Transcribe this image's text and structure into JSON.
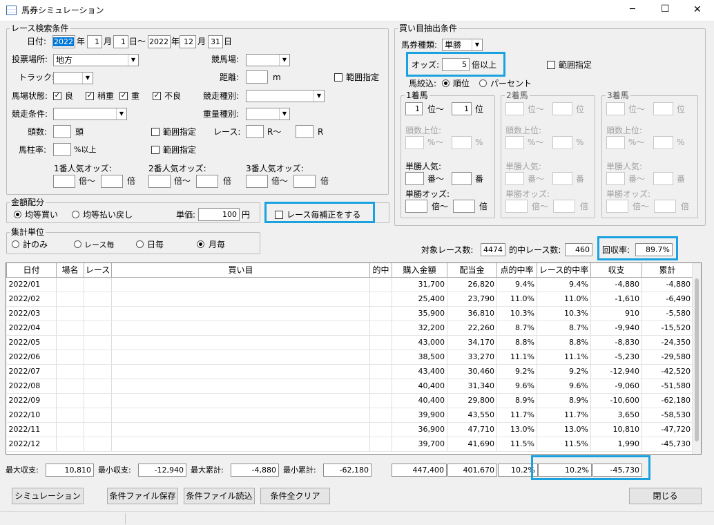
{
  "window": {
    "title": "馬券シミュレーション",
    "min": "─",
    "max": "☐",
    "close": "✕"
  },
  "race": {
    "group_title": "レース検索条件",
    "date_label": "日付:",
    "from_year": "2022",
    "year_unit": "年",
    "from_month": "1",
    "month_unit": "月",
    "from_day": "1",
    "day_tilde": "日〜",
    "to_year": "2022",
    "to_month": "12",
    "to_day": "31",
    "day_unit": "日",
    "venue_label": "投票場所:",
    "venue_value": "地方",
    "course_label": "競馬場:",
    "track_label": "トラック:",
    "distance_label": "距離:",
    "distance_unit": "m",
    "range_label": "範囲指定",
    "condition_label": "馬場状態:",
    "conditions": [
      "良",
      "稍重",
      "重",
      "不良"
    ],
    "race_kind_label": "競走種別:",
    "race_cond_label": "競走条件:",
    "weight_label": "重量種別:",
    "heads_label": "頭数:",
    "heads_unit": "頭",
    "heads_range": "範囲指定",
    "race_label": "レース:",
    "race_r_from": "R〜",
    "race_r": "R",
    "umabashira_label": "馬柱率:",
    "umabashira_unit": "%以上",
    "umabashira_range": "範囲指定",
    "pop1_label": "1番人気オッズ:",
    "pop2_label": "2番人気オッズ:",
    "pop3_label": "3番人気オッズ:",
    "times_from": "倍〜",
    "times": "倍"
  },
  "amount": {
    "group_title": "金額配分",
    "opt1": "均等買い",
    "opt2": "均等払い戻し",
    "unit_label": "単価:",
    "unit_value": "100",
    "unit_yen": "円",
    "correct_label": "レース毎補正をする"
  },
  "aggregate": {
    "group_title": "集計単位",
    "opts": [
      "計のみ",
      "レース毎",
      "日毎",
      "月毎"
    ]
  },
  "buy": {
    "group_title": "買い目抽出条件",
    "type_label": "馬券種類:",
    "type_value": "単勝",
    "odds_label": "オッズ:",
    "odds_value": "5",
    "odds_unit": "倍以上",
    "range_label": "範囲指定",
    "narrow_label": "馬絞込:",
    "narrow_rank": "順位",
    "narrow_pct": "パーセント",
    "h1_title": "1着馬",
    "h2_title": "2着馬",
    "h3_title": "3着馬",
    "h1_from": "1",
    "h1_to": "1",
    "rank_from": "位〜",
    "rank": "位",
    "heads_top": "頭数上位:",
    "pct_from": "%〜",
    "pct": "%",
    "pop_label": "単勝人気:",
    "ban_from": "番〜",
    "ban": "番",
    "odds_tan": "単勝オッズ:",
    "bai_from": "倍〜",
    "bai": "倍"
  },
  "summary": {
    "target_label": "対象レース数:",
    "target_value": "4474",
    "hit_label": "的中レース数:",
    "hit_value": "460",
    "recovery_label": "回収率:",
    "recovery_value": "89.7%"
  },
  "table": {
    "headers": [
      "日付",
      "場名",
      "レース",
      "買い目",
      "的中",
      "購入金額",
      "配当金",
      "点的中率",
      "レース的中率",
      "収支",
      "累計"
    ],
    "rows": [
      [
        "2022/01",
        "",
        "",
        "",
        "",
        "31,700",
        "26,820",
        "9.4%",
        "9.4%",
        "-4,880",
        "-4,880"
      ],
      [
        "2022/02",
        "",
        "",
        "",
        "",
        "25,400",
        "23,790",
        "11.0%",
        "11.0%",
        "-1,610",
        "-6,490"
      ],
      [
        "2022/03",
        "",
        "",
        "",
        "",
        "35,900",
        "36,810",
        "10.3%",
        "10.3%",
        "910",
        "-5,580"
      ],
      [
        "2022/04",
        "",
        "",
        "",
        "",
        "32,200",
        "22,260",
        "8.7%",
        "8.7%",
        "-9,940",
        "-15,520"
      ],
      [
        "2022/05",
        "",
        "",
        "",
        "",
        "43,000",
        "34,170",
        "8.8%",
        "8.8%",
        "-8,830",
        "-24,350"
      ],
      [
        "2022/06",
        "",
        "",
        "",
        "",
        "38,500",
        "33,270",
        "11.1%",
        "11.1%",
        "-5,230",
        "-29,580"
      ],
      [
        "2022/07",
        "",
        "",
        "",
        "",
        "43,400",
        "30,460",
        "9.2%",
        "9.2%",
        "-12,940",
        "-42,520"
      ],
      [
        "2022/08",
        "",
        "",
        "",
        "",
        "40,400",
        "31,340",
        "9.6%",
        "9.6%",
        "-9,060",
        "-51,580"
      ],
      [
        "2022/09",
        "",
        "",
        "",
        "",
        "40,400",
        "29,800",
        "8.9%",
        "8.9%",
        "-10,600",
        "-62,180"
      ],
      [
        "2022/10",
        "",
        "",
        "",
        "",
        "39,900",
        "43,550",
        "11.7%",
        "11.7%",
        "3,650",
        "-58,530"
      ],
      [
        "2022/11",
        "",
        "",
        "",
        "",
        "36,900",
        "47,710",
        "13.0%",
        "13.0%",
        "10,810",
        "-47,720"
      ],
      [
        "2022/12",
        "",
        "",
        "",
        "",
        "39,700",
        "41,690",
        "11.5%",
        "11.5%",
        "1,990",
        "-45,730"
      ]
    ]
  },
  "totals": {
    "max_income_label": "最大収支:",
    "max_income": "10,810",
    "min_income_label": "最小収支:",
    "min_income": "-12,940",
    "max_cum_label": "最大累計:",
    "max_cum": "-4,880",
    "min_cum_label": "最小累計:",
    "min_cum": "-62,180",
    "purchase": "447,400",
    "payout": "401,670",
    "hit_rate": "10.2%",
    "race_hit_rate": "10.2%",
    "total": "-45,730"
  },
  "buttons": {
    "simulate": "シミュレーション",
    "save": "条件ファイル保存",
    "load": "条件ファイル読込",
    "clear": "条件全クリア",
    "close": "閉じる"
  },
  "colors": {
    "highlight": "#1aa1e0"
  }
}
